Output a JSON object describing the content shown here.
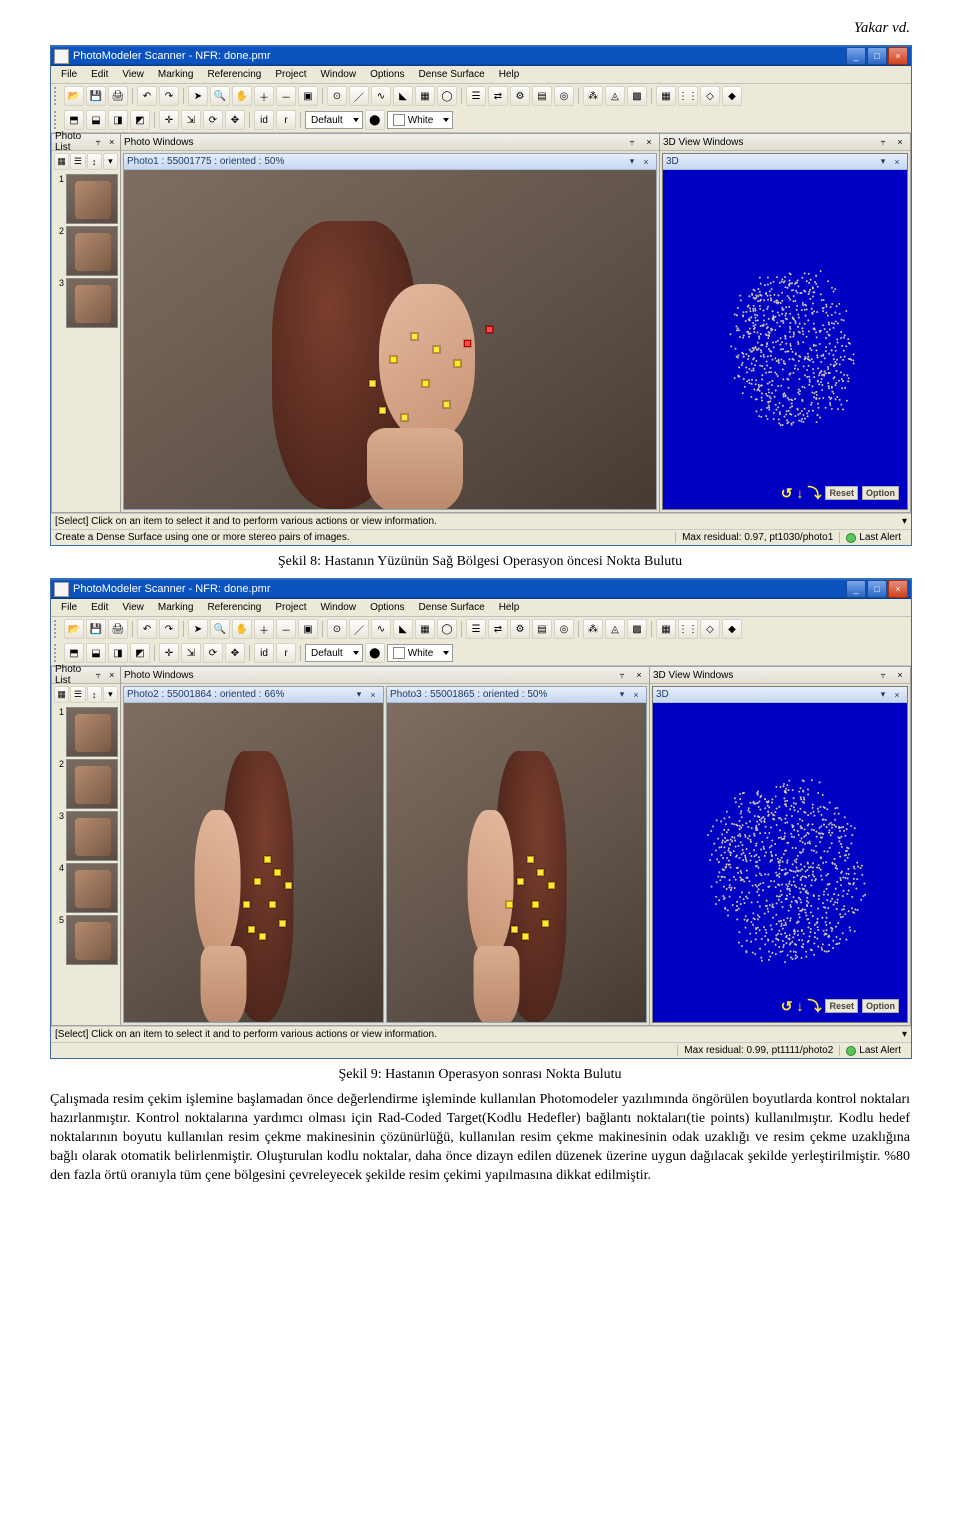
{
  "header_author": "Yakar vd.",
  "app1": {
    "title": "PhotoModeler Scanner - NFR: done.pmr",
    "menu": [
      "File",
      "Edit",
      "View",
      "Marking",
      "Referencing",
      "Project",
      "Window",
      "Options",
      "Dense Surface",
      "Help"
    ],
    "combo_style": "Default",
    "combo_color": "White",
    "panes": {
      "photo_list": "Photo List",
      "photo_windows": "Photo Windows",
      "three_d": "3D View Windows"
    },
    "views": {
      "left": "Photo1 : 55001775 : oriented : 50%",
      "td": "3D"
    },
    "nav": {
      "reset": "Reset",
      "option": "Option"
    },
    "thumbs": [
      "1",
      "2",
      "3"
    ],
    "select_hint": "[Select]  Click on an item to select it and to perform various actions or view information.",
    "status_left": "Create a Dense Surface using one or more stereo pairs of images.",
    "status_residual": "Max residual: 0.97, pt1030/photo1",
    "status_alert": "Last Alert"
  },
  "caption1": "Şekil 8: Hastanın Yüzünün Sağ Bölgesi Operasyon öncesi Nokta Bulutu",
  "app2": {
    "title": "PhotoModeler Scanner - NFR: done.pmr",
    "menu": [
      "File",
      "Edit",
      "View",
      "Marking",
      "Referencing",
      "Project",
      "Window",
      "Options",
      "Dense Surface",
      "Help"
    ],
    "combo_style": "Default",
    "combo_color": "White",
    "panes": {
      "photo_list": "Photo List",
      "photo_windows": "Photo Windows",
      "three_d": "3D View Windows"
    },
    "views": {
      "left": "Photo2 : 55001864 : oriented : 66%",
      "right": "Photo3 : 55001865 : oriented : 50%",
      "td": "3D"
    },
    "nav": {
      "reset": "Reset",
      "option": "Option"
    },
    "thumbs": [
      "1",
      "2",
      "3",
      "4",
      "5"
    ],
    "select_hint": "[Select]  Click on an item to select it and to perform various actions or view information.",
    "status_left": " ",
    "status_residual": "Max residual: 0.99, pt1111/photo2",
    "status_alert": "Last Alert"
  },
  "caption2": "Şekil 9: Hastanın Operasyon sonrası Nokta Bulutu",
  "paragraph": "Çalışmada resim çekim işlemine başlamadan önce değerlendirme işleminde kullanılan Photomodeler yazılımında öngörülen boyutlarda kontrol noktaları hazırlanmıştır. Kontrol noktalarına yardımcı olması için Rad-Coded Target(Kodlu Hedefler) bağlantı noktaları(tie points) kullanılmıştır. Kodlu hedef noktalarının boyutu kullanılan resim çekme makinesinin çözünürlüğü, kullanılan resim çekme makinesinin odak uzaklığı ve resim çekme uzaklığına bağlı olarak otomatik belirlenmiştir. Oluşturulan kodlu noktalar, daha önce dizayn edilen düzenek üzerine uygun dağılacak şekilde yerleştirilmiştir. %80 den fazla örtü oranıyla tüm çene bölgesini çevreleyecek şekilde resim çekimi yapılmasına dikkat edilmiştir."
}
